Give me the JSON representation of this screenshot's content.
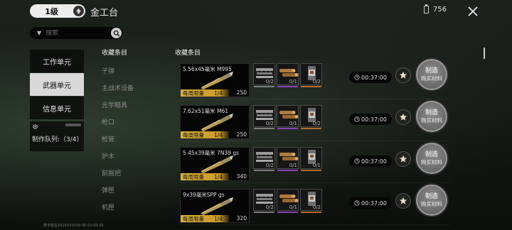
{
  "header": {
    "level": "1级",
    "title": "金工台",
    "currency_amount": "756"
  },
  "search": {
    "placeholder": "搜索"
  },
  "units": [
    {
      "label": "工作单元",
      "active": false
    },
    {
      "label": "武器单元",
      "active": true
    },
    {
      "label": "信息单元",
      "active": false
    }
  ],
  "queue": {
    "label": "制作队列:（3/4）"
  },
  "categories": {
    "header": "收藏条目",
    "items": [
      "子弹",
      "主战术设备",
      "光学瞄具",
      "枪口",
      "枪管",
      "护木",
      "前握把",
      "弹匣",
      "机匣"
    ]
  },
  "list": {
    "header": "收藏条目",
    "rows": [
      {
        "name": "5.56x45毫米 M995",
        "limit_label": "每周限量",
        "limit_count": "1/4",
        "count": "250",
        "materials": [
          {
            "type": "metal-parts",
            "count": "0/2",
            "bar": "#7c7c7c"
          },
          {
            "type": "wood-logs",
            "count": "0/1",
            "bar": "#8b3fb8"
          },
          {
            "type": "powder-can",
            "count": "0/2",
            "bar": "#b36a2e"
          }
        ],
        "timer": "00:37:00",
        "craft_label": "制造",
        "buy_label": "购买材料"
      },
      {
        "name": "7.62x51毫米 M61",
        "limit_label": "每周限量",
        "limit_count": "1/4",
        "count": "250",
        "materials": [
          {
            "type": "metal-parts",
            "count": "0/2",
            "bar": "#7c7c7c"
          },
          {
            "type": "wood-logs",
            "count": "0/1",
            "bar": "#8b3fb8"
          },
          {
            "type": "powder-can",
            "count": "0/2",
            "bar": "#b36a2e"
          }
        ],
        "timer": "00:37:00",
        "craft_label": "制造",
        "buy_label": "购买材料"
      },
      {
        "name": "5.45x39毫米 7N39 gs",
        "limit_label": "每周限量",
        "limit_count": "1/4",
        "count": "340",
        "materials": [
          {
            "type": "metal-parts",
            "count": "0/2",
            "bar": "#7c7c7c"
          },
          {
            "type": "wood-logs",
            "count": "0/1",
            "bar": "#8b3fb8"
          },
          {
            "type": "powder-can",
            "count": "0/1",
            "bar": "#b36a2e"
          }
        ],
        "timer": "00:37:00",
        "craft_label": "制造",
        "buy_label": "购买材料"
      },
      {
        "name": "9x39毫米SPP gs",
        "limit_label": "每周限量",
        "limit_count": "1/4",
        "count": "320",
        "materials": [
          {
            "type": "metal-parts",
            "count": "0/2",
            "bar": "#7c7c7c"
          },
          {
            "type": "wood-logs",
            "count": "0/1",
            "bar": "#8b3fb8"
          },
          {
            "type": "powder-can",
            "count": "0/2",
            "bar": "#b36a2e"
          }
        ],
        "timer": "00:37:00",
        "craft_label": "制造",
        "buy_label": "购买材料"
      }
    ]
  },
  "footer": {
    "build_id": "数字签名20240310S9-06-23-09:39"
  },
  "colors": {
    "accent_gold": "#d9b13a",
    "active_unit": "#d9d9d9"
  }
}
